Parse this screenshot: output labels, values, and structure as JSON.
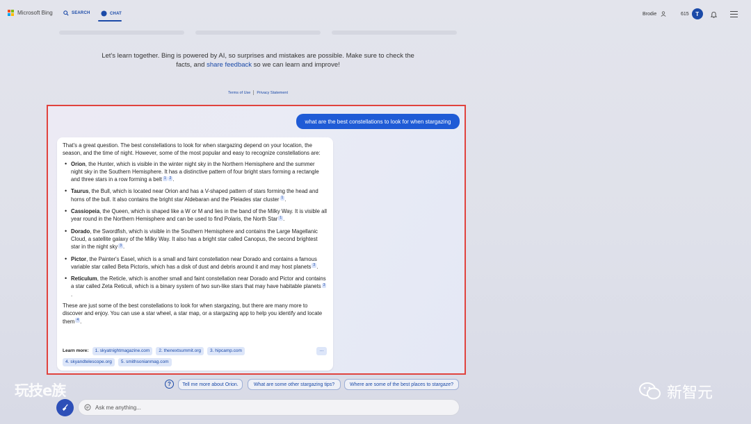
{
  "header": {
    "brand": "Microsoft Bing",
    "tabs": [
      {
        "label": "SEARCH",
        "icon": "search-icon"
      },
      {
        "label": "CHAT",
        "icon": "chat-bubble-icon"
      }
    ],
    "user_name": "Brodie",
    "points": "615",
    "medal_letter": "T"
  },
  "disclaimer": {
    "line1": "Let's learn together. Bing is powered by AI, so surprises and mistakes are possible. Make sure to check the",
    "pre": "facts, and ",
    "link": "share feedback",
    "post": " so we can learn and improve!"
  },
  "legal": {
    "terms": "Terms of Use",
    "privacy": "Privacy Statement"
  },
  "conversation": {
    "user_message": "what are the best constellations to look for when stargazing",
    "intro": "That's a great question. The best constellations to look for when stargazing depend on your location, the season, and the time of night. However, some of the most popular and easy to recognize constellations are:",
    "items": [
      {
        "name": "Orion",
        "text": ", the Hunter, which is visible in the winter night sky in the Northern Hemisphere and the summer night sky in the Southern Hemisphere. It has a distinctive pattern of four bright stars forming a rectangle and three stars in a row forming a belt",
        "cites": [
          "1",
          "2"
        ]
      },
      {
        "name": "Taurus",
        "text": ", the Bull, which is located near Orion and has a V-shaped pattern of stars forming the head and horns of the bull. It also contains the bright star Aldebaran and the Pleiades star cluster",
        "cites": [
          "1"
        ]
      },
      {
        "name": "Cassiopeia",
        "text": ", the Queen, which is shaped like a W or M and lies in the band of the Milky Way. It is visible all year round in the Northern Hemisphere and can be used to find Polaris, the North Star",
        "cites": [
          "1"
        ]
      },
      {
        "name": "Dorado",
        "text": ", the Swordfish, which is visible in the Southern Hemisphere and contains the Large Magellanic Cloud, a satellite galaxy of the Milky Way. It also has a bright star called Canopus, the second brightest star in the night sky",
        "cites": [
          "3"
        ]
      },
      {
        "name": "Pictor",
        "text": ", the Painter's Easel, which is a small and faint constellation near Dorado and contains a famous variable star called Beta Pictoris, which has a disk of dust and debris around it and may host planets",
        "cites": [
          "3"
        ]
      },
      {
        "name": "Reticulum",
        "text": ", the Reticle, which is another small and faint constellation near Dorado and Pictor and contains a star called Zeta Reticuli, which is a binary system of two sun-like stars that may have habitable planets",
        "cites": [
          "3"
        ]
      }
    ],
    "outro": "These are just some of the best constellations to look for when stargazing, but there are many more to discover and enjoy. You can use a star wheel, a star map, or a stargazing app to help you identify and locate them",
    "outro_cite": "4",
    "learn_more_label": "Learn more:",
    "sources": [
      "1. skyatnightmagazine.com",
      "2. thenextsummit.org",
      "3. hipcamp.com",
      "4. skyandtelescope.org",
      "5. smithsonianmag.com"
    ],
    "more_label": "…"
  },
  "suggestions": [
    "Tell me more about Orion.",
    "What are some other stargazing tips?",
    "Where are some of the best places to stargaze?"
  ],
  "input": {
    "placeholder": "Ask me anything..."
  },
  "watermarks": {
    "left": "玩技e族",
    "right": "新智元"
  },
  "colors": {
    "accent": "#1b4aa8",
    "user_bubble": "#1f5bd6",
    "highlight_border": "#e0423d"
  }
}
